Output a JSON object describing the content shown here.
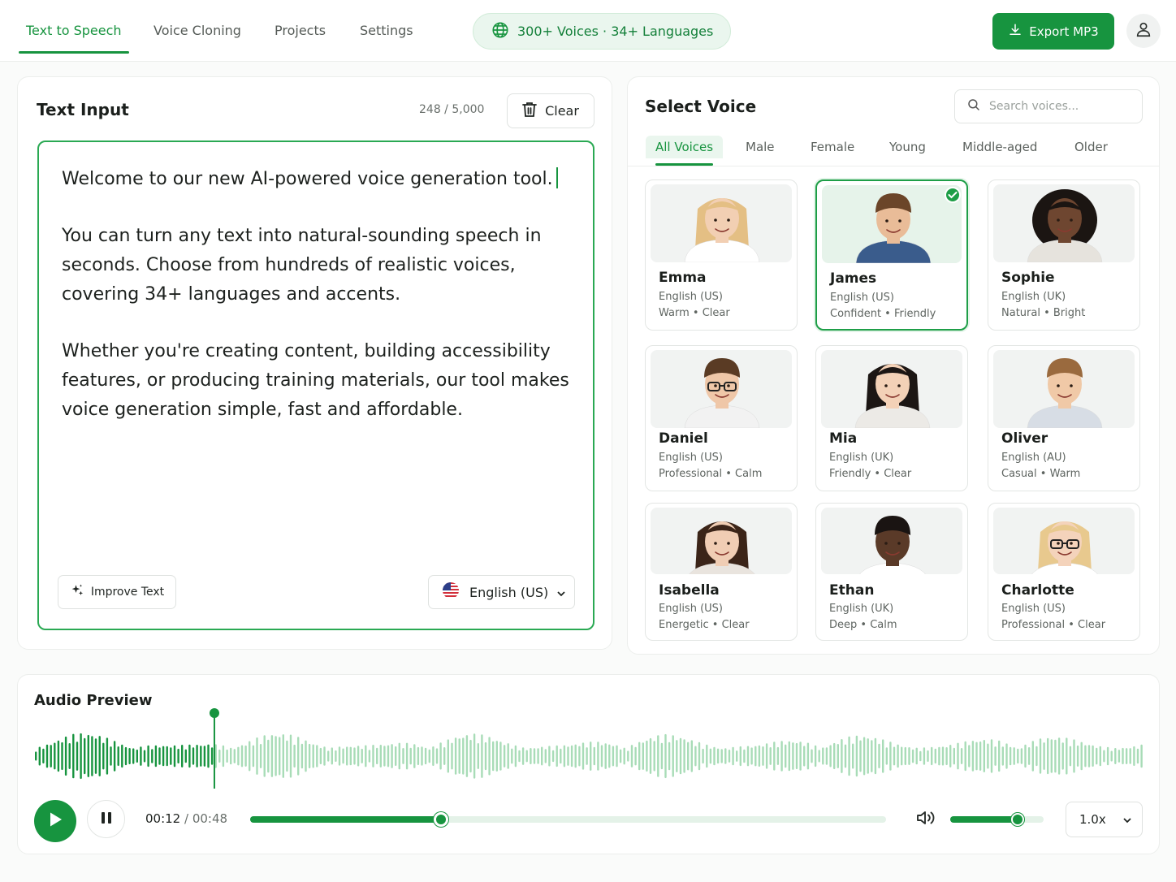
{
  "nav": {
    "tabs": [
      {
        "label": "Text to Speech",
        "active": true
      },
      {
        "label": "Voice Cloning",
        "active": false
      },
      {
        "label": "Projects",
        "active": false
      },
      {
        "label": "Settings",
        "active": false
      }
    ],
    "pill_text": "300+ Voices · 34+ Languages",
    "export_label": "Export MP3"
  },
  "text_input": {
    "title": "Text Input",
    "char_count": "248 / 5,000",
    "clear_label": "Clear",
    "paragraphs": [
      "Welcome to our new AI-powered voice generation tool.",
      "You can turn any text into natural-sounding speech in seconds. Choose from hundreds of realistic voices, covering 34+ languages and accents.",
      "Whether you're creating content, building accessibility features, or producing training materials, our tool makes voice generation simple, fast and affordable."
    ],
    "improve_label": "Improve Text",
    "language": "English (US)"
  },
  "voices": {
    "title": "Select Voice",
    "search_placeholder": "Search voices...",
    "filters": [
      "All Voices",
      "Male",
      "Female",
      "Young",
      "Middle-aged",
      "Older"
    ],
    "active_filter": "All Voices",
    "items": [
      {
        "name": "Emma",
        "lang": "English (US)",
        "tags": "Warm • Clear",
        "selected": false
      },
      {
        "name": "James",
        "lang": "English (US)",
        "tags": "Confident • Friendly",
        "selected": true
      },
      {
        "name": "Sophie",
        "lang": "English (UK)",
        "tags": "Natural • Bright",
        "selected": false
      },
      {
        "name": "Daniel",
        "lang": "English (US)",
        "tags": "Professional • Calm",
        "selected": false
      },
      {
        "name": "Mia",
        "lang": "English (UK)",
        "tags": "Friendly • Clear",
        "selected": false
      },
      {
        "name": "Oliver",
        "lang": "English (AU)",
        "tags": "Casual • Warm",
        "selected": false
      },
      {
        "name": "Isabella",
        "lang": "English (US)",
        "tags": "Energetic • Clear",
        "selected": false
      },
      {
        "name": "Ethan",
        "lang": "English (UK)",
        "tags": "Deep • Calm",
        "selected": false
      },
      {
        "name": "Charlotte",
        "lang": "English (US)",
        "tags": "Professional • Clear",
        "selected": false
      }
    ]
  },
  "audio": {
    "title": "Audio Preview",
    "current_time": "00:12",
    "total_time": "/ 00:48",
    "progress_fraction": 0.3,
    "volume_fraction": 0.72,
    "speed": "1.0x"
  },
  "colors": {
    "accent": "#17943f",
    "accent_light": "#a8dcb7",
    "accent_bg": "#eaf6ee"
  }
}
